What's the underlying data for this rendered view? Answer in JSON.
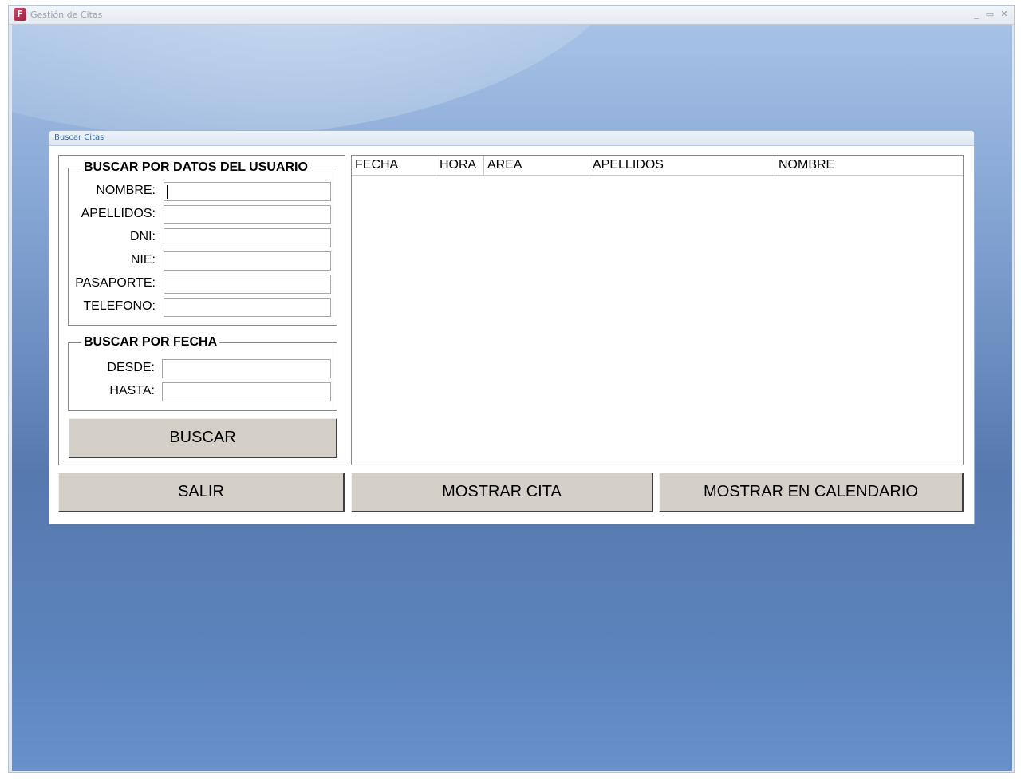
{
  "window": {
    "title": "Gestión de Citas",
    "app_icon_glyph": "F"
  },
  "window_controls": {
    "minimize": "_",
    "maximize": "▭",
    "close": "✕"
  },
  "form": {
    "title": "Buscar Citas",
    "user_group": {
      "legend": "BUSCAR POR DATOS DEL USUARIO",
      "fields": {
        "nombre": {
          "label": "NOMBRE:",
          "value": ""
        },
        "apellidos": {
          "label": "APELLIDOS:",
          "value": ""
        },
        "dni": {
          "label": "DNI:",
          "value": ""
        },
        "nie": {
          "label": "NIE:",
          "value": ""
        },
        "pasaporte": {
          "label": "PASAPORTE:",
          "value": ""
        },
        "telefono": {
          "label": "TELEFONO:",
          "value": ""
        }
      }
    },
    "date_group": {
      "legend": "BUSCAR POR FECHA",
      "fields": {
        "desde": {
          "label": "DESDE:",
          "value": ""
        },
        "hasta": {
          "label": "HASTA:",
          "value": ""
        }
      }
    },
    "buttons": {
      "buscar": "BUSCAR",
      "salir": "SALIR",
      "mostrar_cita": "MOSTRAR CITA",
      "mostrar_calendario": "MOSTRAR EN CALENDARIO"
    },
    "results_table": {
      "columns": [
        "FECHA",
        "HORA",
        "AREA",
        "APELLIDOS",
        "NOMBRE"
      ],
      "rows": []
    }
  },
  "colors": {
    "button_face": "#d4d0c8",
    "form_title_text": "#3f6aa3",
    "desktop_top": "#a6c2e6",
    "desktop_bottom": "#6891cc"
  }
}
